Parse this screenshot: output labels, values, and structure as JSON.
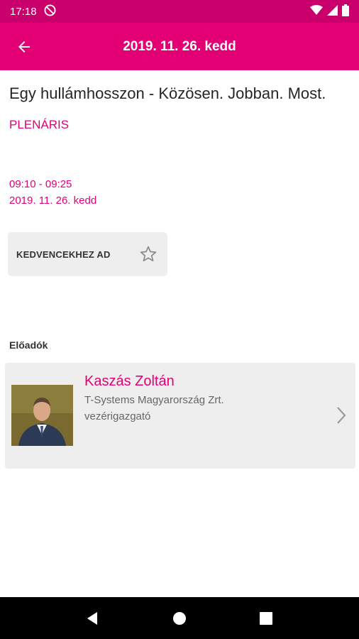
{
  "status_bar": {
    "time": "17:18",
    "icons": [
      "no-disturb-icon",
      "wifi-icon",
      "signal-icon",
      "battery-icon"
    ]
  },
  "app_bar": {
    "title": "2019. 11. 26. kedd",
    "back_icon": "arrow-left-icon"
  },
  "session": {
    "title": "Egy hullámhosszon - Közösen. Jobban. Most.",
    "type": "PLENÁRIS",
    "time_range": "09:10 - 09:25",
    "date": "2019. 11. 26. kedd"
  },
  "favorite": {
    "label": "KEDVENCEKHEZ AD",
    "icon": "star-outline-icon"
  },
  "speakers": {
    "heading": "Előadók",
    "items": [
      {
        "name": "Kaszás Zoltán",
        "company": "T-Systems Magyarország Zrt.",
        "role": "vezérigazgató"
      }
    ]
  },
  "colors": {
    "brand": "#e20074",
    "status_bar": "#c9006b",
    "card_bg": "#eeeeee",
    "nav_bar": "#000000"
  },
  "nav": {
    "icons": [
      "back-triangle-icon",
      "home-circle-icon",
      "recents-square-icon"
    ]
  }
}
